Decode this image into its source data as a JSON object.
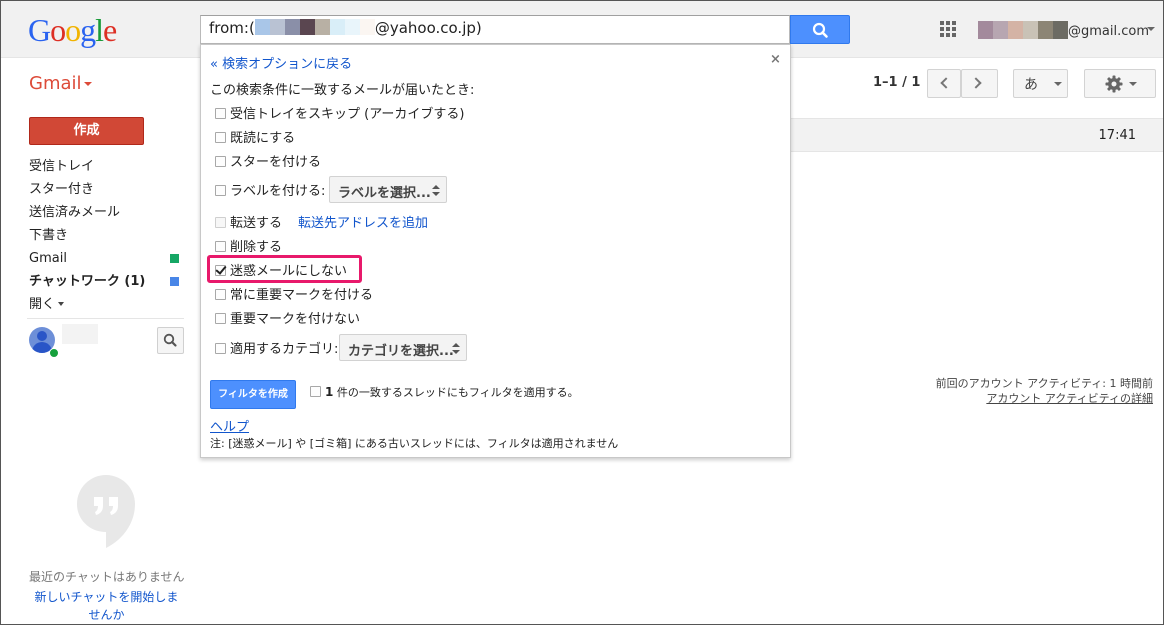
{
  "brand": {
    "logo_letters": [
      {
        "ch": "G",
        "color": "#2a63f0"
      },
      {
        "ch": "o",
        "color": "#dd2f24"
      },
      {
        "ch": "o",
        "color": "#f1b300"
      },
      {
        "ch": "g",
        "color": "#2a63f0"
      },
      {
        "ch": "l",
        "color": "#1a9b3a"
      },
      {
        "ch": "e",
        "color": "#dd2f24"
      }
    ],
    "accent_red": "#d14836",
    "accent_blue": "#4d90fe",
    "link_blue": "#1155cc",
    "highlight_pink": "#e8196b"
  },
  "header": {
    "search_prefix": "from:(",
    "search_suffix": "@yahoo.co.jp)",
    "search_blur_colors": [
      "#a9c6e8",
      "#b9c2d3",
      "#8a8fa8",
      "#5a4650",
      "#b8b0a4",
      "#d9eef8",
      "#e9f5fb",
      "#fbf6f2"
    ],
    "account_blur_colors": [
      "#a38a9c",
      "#b7a6b1",
      "#d4b3a5",
      "#c9c2b6",
      "#8c8575",
      "#6c6b63"
    ],
    "account_suffix": "@gmail.com",
    "icons": {
      "search": "search-icon",
      "apps": "apps-grid-icon",
      "account_menu": "chevron-down-icon"
    }
  },
  "sidebar": {
    "gmail_label": "Gmail",
    "compose_label": "作成",
    "items": [
      {
        "label": "受信トレイ",
        "bold": false,
        "color": ""
      },
      {
        "label": "スター付き",
        "bold": false,
        "color": ""
      },
      {
        "label": "送信済みメール",
        "bold": false,
        "color": ""
      },
      {
        "label": "下書き",
        "bold": false,
        "color": ""
      },
      {
        "label": "Gmail",
        "bold": false,
        "color": "#16a765"
      },
      {
        "label": "チャットワーク (1)",
        "bold": true,
        "color": "#4986e7"
      }
    ],
    "more_label": "開く",
    "chat": {
      "no_recent": "最近のチャットはありません",
      "start_new": "新しいチャットを開始しませんか",
      "presence_color": "#16a03c"
    }
  },
  "main": {
    "range_text": "1–1 / 1",
    "input_tool_label": "あ",
    "mail_row_time": "17:41",
    "activity_text": "前回のアカウント アクティビティ: 1 時間前",
    "activity_link": "アカウント アクティビティの詳細"
  },
  "filter_popup": {
    "close_label": "×",
    "back_link": "« 検索オプションに戻る",
    "intro": "この検索条件に一致するメールが届いたとき:",
    "options": [
      {
        "id": "skip_inbox",
        "label": "受信トレイをスキップ (アーカイブする)",
        "checked": false
      },
      {
        "id": "mark_read",
        "label": "既読にする",
        "checked": false
      },
      {
        "id": "star",
        "label": "スターを付ける",
        "checked": false
      },
      {
        "id": "apply_label",
        "label": "ラベルを付ける:",
        "checked": false
      },
      {
        "id": "forward",
        "label": "転送する",
        "checked": false
      },
      {
        "id": "delete",
        "label": "削除する",
        "checked": false
      },
      {
        "id": "never_spam",
        "label": "迷惑メールにしない",
        "checked": true
      },
      {
        "id": "always_important",
        "label": "常に重要マークを付ける",
        "checked": false
      },
      {
        "id": "never_important",
        "label": "重要マークを付けない",
        "checked": false
      },
      {
        "id": "category",
        "label": "適用するカテゴリ:",
        "checked": false
      }
    ],
    "label_select": "ラベルを選択...",
    "forward_link": "転送先アドレスを追加",
    "category_select": "カテゴリを選択...",
    "create_button": "フィルタを作成",
    "apply_count": "1",
    "apply_text": " 件の一致するスレッドにもフィルタを適用する。",
    "apply_checked": false,
    "help_link": "ヘルプ",
    "note": "注: [迷惑メール] や [ゴミ箱] にある古いスレッドには、フィルタは適用されません"
  }
}
